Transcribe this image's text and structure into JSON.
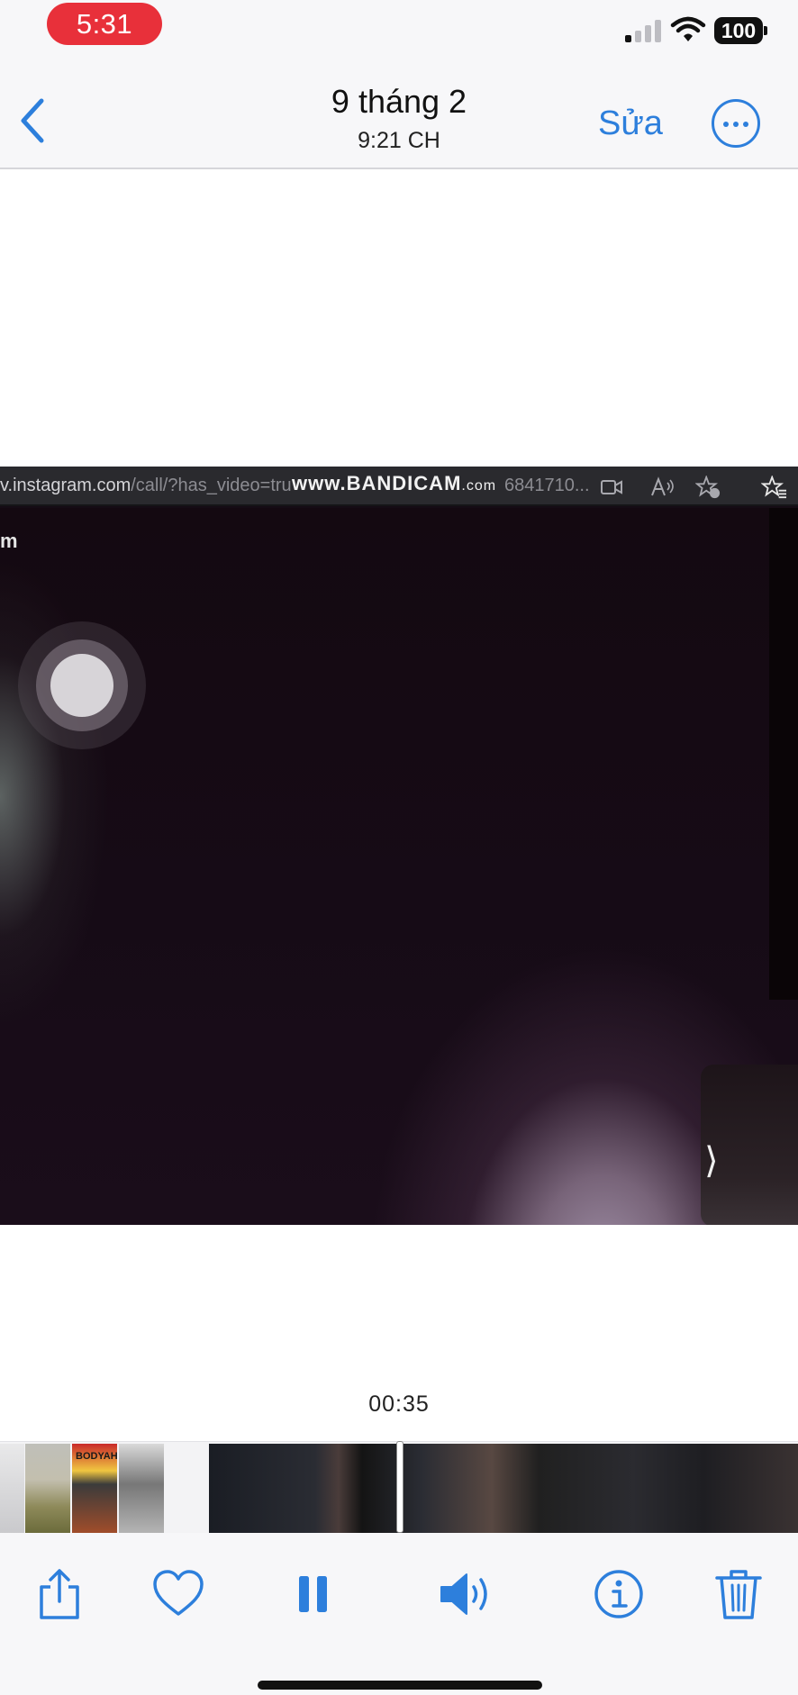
{
  "status_bar": {
    "time": "5:31",
    "battery": "100",
    "colors": {
      "time_pill": "#e8303a"
    }
  },
  "nav": {
    "back_icon": "chevron-left-icon",
    "title": "9 tháng 2",
    "subtitle": "9:21 CH",
    "edit_label": "Sửa",
    "more_icon": "ellipsis-circle-icon",
    "accent_color": "#2d7fdc"
  },
  "video": {
    "browser": {
      "url_host": "v.instagram.com",
      "url_path": "/call/?has_video=tru",
      "url_tail": "6841710...",
      "watermark_main": "www.BANDICAM",
      "watermark_suffix": ".com",
      "icons": [
        "video-camera-icon",
        "read-aloud-icon",
        "favorite-add-icon",
        "favorites-icon"
      ]
    },
    "side_letter": "m",
    "pip_icon": "chevron-right-icon"
  },
  "player": {
    "timecode": "00:35",
    "scrubber_icons": [
      "thumbnail-strip"
    ],
    "thumbnail_text": "BODYAH"
  },
  "toolbar": {
    "share_icon": "share-icon",
    "favorite_icon": "heart-icon",
    "pause_icon": "pause-icon",
    "volume_icon": "speaker-icon",
    "info_icon": "info-icon",
    "delete_icon": "trash-icon"
  }
}
